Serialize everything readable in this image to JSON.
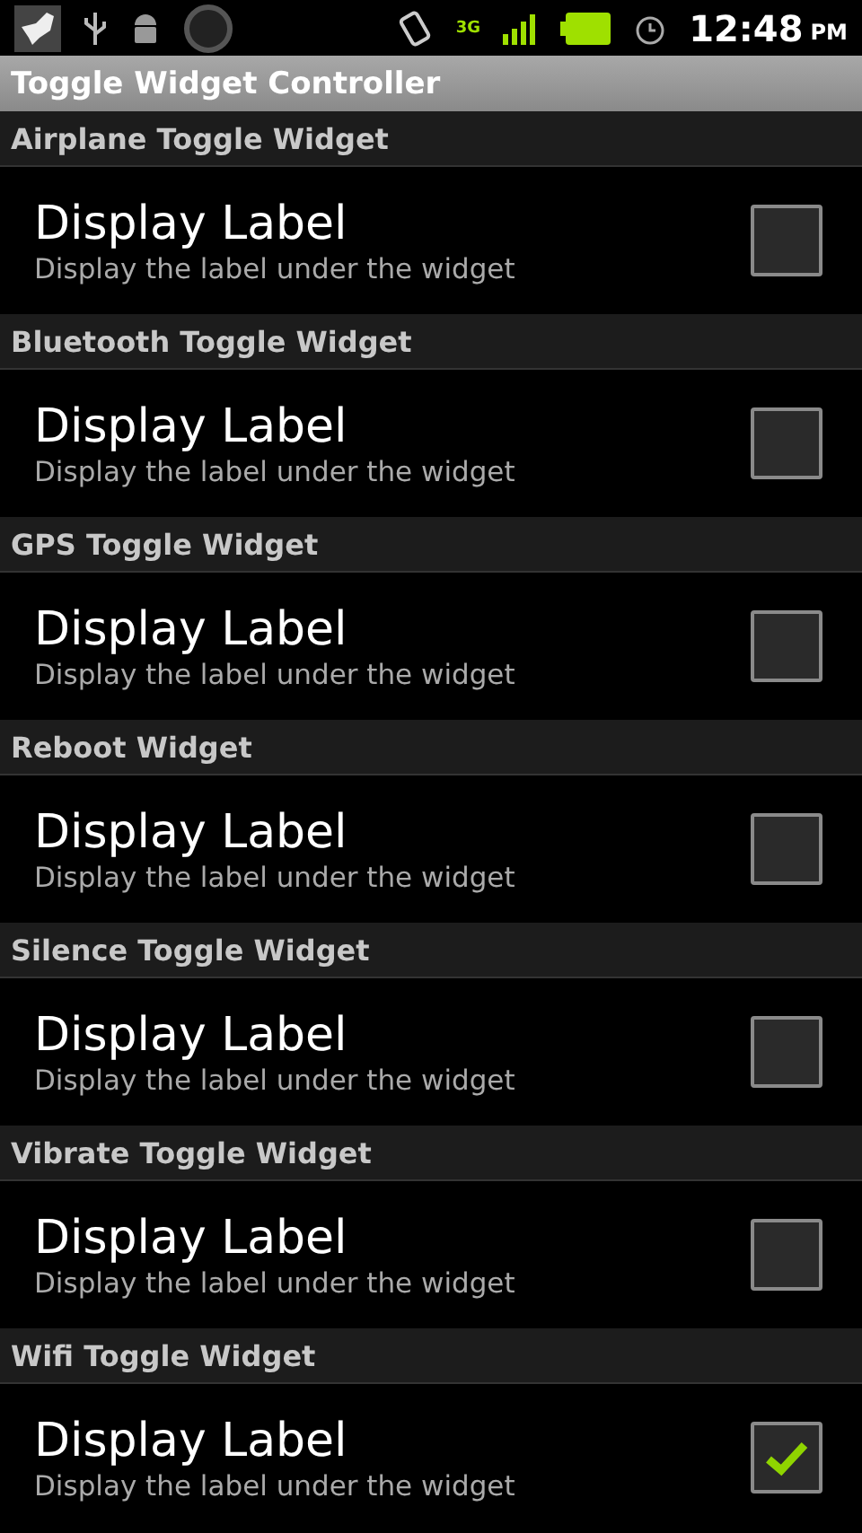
{
  "status_bar": {
    "network": "3G",
    "time": "12:48",
    "ampm": "PM"
  },
  "title": "Toggle Widget Controller",
  "sections": [
    {
      "header": "Airplane Toggle Widget",
      "title": "Display Label",
      "summary": "Display the label under the widget",
      "checked": false
    },
    {
      "header": "Bluetooth Toggle Widget",
      "title": "Display Label",
      "summary": "Display the label under the widget",
      "checked": false
    },
    {
      "header": "GPS Toggle Widget",
      "title": "Display Label",
      "summary": "Display the label under the widget",
      "checked": false
    },
    {
      "header": "Reboot Widget",
      "title": "Display Label",
      "summary": "Display the label under the widget",
      "checked": false
    },
    {
      "header": "Silence Toggle Widget",
      "title": "Display Label",
      "summary": "Display the label under the widget",
      "checked": false
    },
    {
      "header": "Vibrate Toggle Widget",
      "title": "Display Label",
      "summary": "Display the label under the widget",
      "checked": false
    },
    {
      "header": "Wifi Toggle Widget",
      "title": "Display Label",
      "summary": "Display the label under the widget",
      "checked": true
    }
  ]
}
